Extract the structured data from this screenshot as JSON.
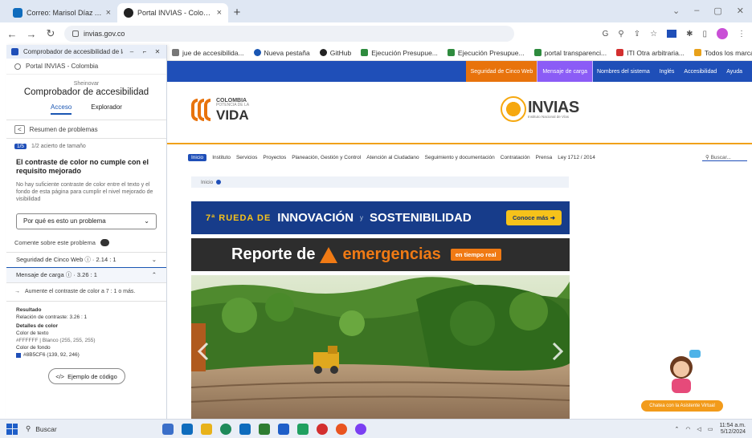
{
  "browser": {
    "tabs": [
      {
        "label": "Correo: Marisol Díaz Angarita - ...",
        "icon_color": "#0f6cbd"
      },
      {
        "label": "Portal INVIAS - Colombia",
        "icon_color": "#222222"
      }
    ],
    "new_tab": "+",
    "url": "invias.gov.co",
    "bookmarks": [
      "jue de accesibilida...",
      "Nueva pestaña",
      "GitHub",
      "Ejecución Presupue...",
      "Ejecución Presupue...",
      "portal transparenci...",
      "ITI Otra arbitraria...",
      "Todos los marcadores"
    ],
    "bookmark_colors": [
      "#777777",
      "#1a56b3",
      "#222222",
      "#2e8b3e",
      "#2e8b3e",
      "#2e8b3e",
      "#d32f2f",
      "#e8a11a"
    ]
  },
  "side_panel": {
    "header_title": "Comprobador de accesibilidad de la ...",
    "url_row": "Portal INVIAS - Colombia",
    "app_name": "Sheinovar",
    "title": "Comprobador de accesibilidad",
    "tabs": [
      "Acceso",
      "Explorador"
    ],
    "back_label": "Resumen de problemas",
    "count_badge": "1/5",
    "count_text": "1/2 acierto de tamaño",
    "issue_title": "El contraste de color no cumple con el requisito mejorado",
    "issue_description": "No hay suficiente contraste de color entre el texto y el fondo de esta página para cumplir el nivel mejorado de visibilidad",
    "dropdown_label": "Por qué es esto un problema",
    "comment_label": "Comente sobre este problema",
    "item1_label": "Seguridad de Cinco Web",
    "item1_ratio": "2.14 : 1",
    "item2_label": "Mensaje de carga",
    "item2_ratio": "3.26 : 1",
    "fix_suggestion": "Aumente el contraste de color a 7 : 1 o más.",
    "result_label": "Resultado",
    "result_value": "Relación de contraste: 3.26 : 1",
    "details_label": "Detalles de color",
    "fg_label": "Color de texto",
    "fg_value": "#FFFFFF | Blanco (255, 255, 255)",
    "bg_label": "Color de fondo",
    "bg_value": "#8B5CF6 (139, 92, 246)",
    "code_button": "Ejemplo de código"
  },
  "site": {
    "gov_links": [
      "Seguridad de Cinco Web",
      "Mensaje de carga",
      "Nombres del sistema",
      "Inglés",
      "Accesibilidad",
      "Ayuda"
    ],
    "gov_link_colors": [
      "#e8730c",
      "#8b5cf6",
      "#1f4fb8",
      "#1f4fb8",
      "#1f4fb8",
      "#1f4fb8"
    ],
    "logo_line1": "COLOMBIA",
    "logo_line2": "POTENCIA DE LA",
    "logo_line3": "VIDA",
    "invias_name": "INVIAS",
    "invias_tagline": "Instituto Nacional de Vías",
    "menu": [
      "Inicio",
      "Instituto",
      "Servicios",
      "Proyectos",
      "Planeación, Gestión y Control",
      "Atención al Ciudadano",
      "Seguimiento y documentación",
      "Contratación",
      "Prensa",
      "Ley 1712 / 2014"
    ],
    "menu_search": "Buscar...",
    "breadcrumb": "Inicio",
    "banner1": {
      "prefix": "7ª RUEDA DE",
      "main": "INNOVACIÓN",
      "joiner": "y",
      "main2": "SOSTENIBILIDAD",
      "button": "Conoce más"
    },
    "banner2": {
      "prefix": "Reporte de",
      "main": "emergencias",
      "tag": "en tiempo real"
    },
    "chat_pill": "Chatea con la Asistente Virtual"
  },
  "taskbar": {
    "search": "Buscar",
    "icon_colors": [
      "#3b6fc9",
      "#0f6cbd",
      "#e8b21a",
      "#1e8a5a",
      "#0f6cbd",
      "#2e7d32",
      "#1e5ec8",
      "#20a060",
      "#d32f2f",
      "#e95420",
      "#7b3ff2"
    ],
    "time": "11:54 a.m.",
    "date": "5/12/2024"
  },
  "colors": {
    "gov_blue": "#1f4fb8",
    "accent_orange": "#f07a14",
    "banner_blue": "#173c8a"
  }
}
